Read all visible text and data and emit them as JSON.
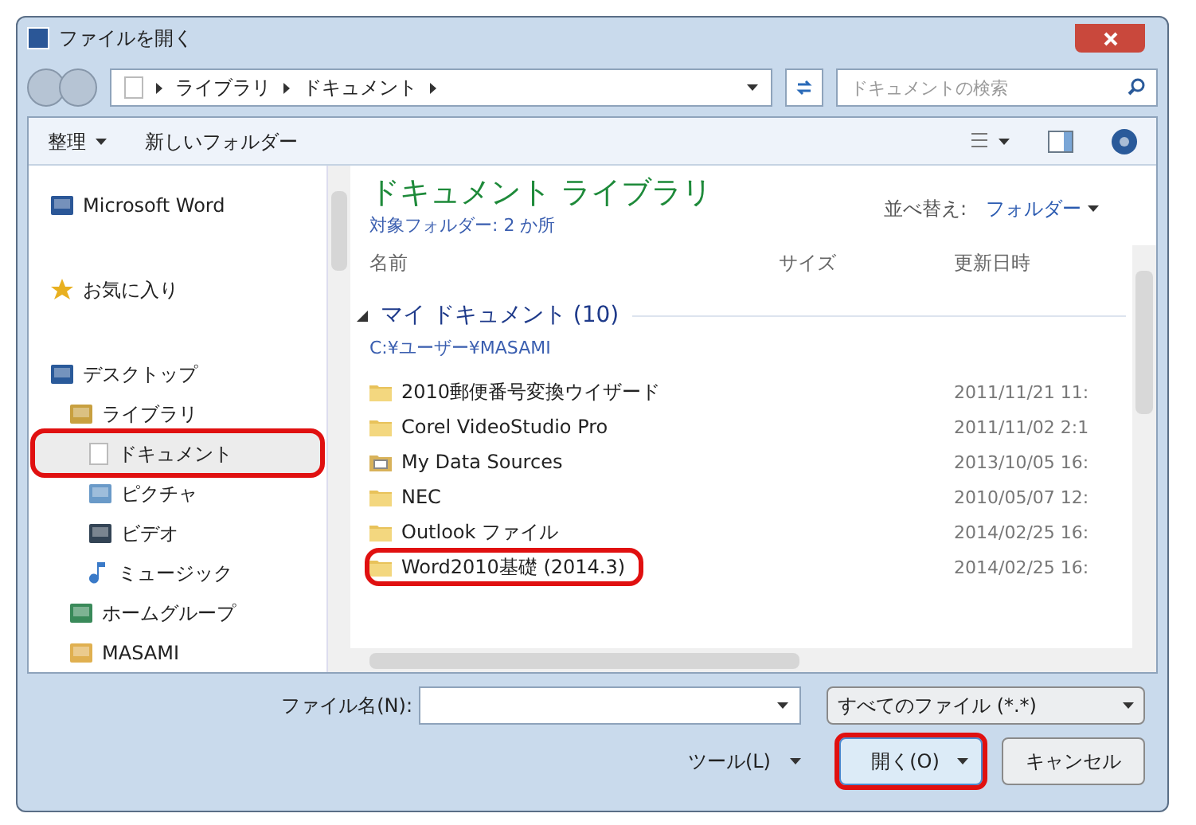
{
  "window": {
    "title": "ファイルを開く"
  },
  "address_bar": {
    "path": [
      "ライブラリ",
      "ドキュメント"
    ],
    "search_placeholder": "ドキュメントの検索"
  },
  "toolbar": {
    "organize": "整理",
    "new_folder": "新しいフォルダー"
  },
  "sidebar": {
    "items": [
      {
        "label": "Microsoft Word",
        "kind": "word",
        "selected": false,
        "annotated": false
      },
      {
        "label": "お気に入り",
        "kind": "star",
        "selected": false,
        "annotated": false
      },
      {
        "label": "デスクトップ",
        "kind": "desktop",
        "selected": false,
        "annotated": false,
        "children": [
          {
            "label": "ライブラリ",
            "kind": "library",
            "selected": false,
            "annotated": false,
            "children": [
              {
                "label": "ドキュメント",
                "kind": "document",
                "selected": true,
                "annotated": true
              },
              {
                "label": "ピクチャ",
                "kind": "picture",
                "selected": false,
                "annotated": false
              },
              {
                "label": "ビデオ",
                "kind": "video",
                "selected": false,
                "annotated": false
              },
              {
                "label": "ミュージック",
                "kind": "music",
                "selected": false,
                "annotated": false
              }
            ]
          },
          {
            "label": "ホームグループ",
            "kind": "homegroup",
            "selected": false,
            "annotated": false
          },
          {
            "label": "MASAMI",
            "kind": "user",
            "selected": false,
            "annotated": false
          }
        ]
      }
    ]
  },
  "library": {
    "title": "ドキュメント ライブラリ",
    "subtitle": "対象フォルダー: 2 か所",
    "sort_label": "並べ替え:",
    "sort_value": "フォルダー"
  },
  "table": {
    "columns": [
      "名前",
      "サイズ",
      "更新日時"
    ],
    "group": {
      "label": "マイ ドキュメント (10)",
      "path": "C:¥ユーザー¥MASAMI",
      "expanded": true
    },
    "rows": [
      {
        "name": "2010郵便番号変換ウイザード",
        "kind": "folder",
        "date": "2011/11/21 11:",
        "annotated": false
      },
      {
        "name": "Corel VideoStudio Pro",
        "kind": "folder",
        "date": "2011/11/02 2:1",
        "annotated": false
      },
      {
        "name": "My Data Sources",
        "kind": "datasource",
        "date": "2013/10/05 16:",
        "annotated": false
      },
      {
        "name": "NEC",
        "kind": "folder",
        "date": "2010/05/07 12:",
        "annotated": false
      },
      {
        "name": "Outlook ファイル",
        "kind": "folder",
        "date": "2014/02/25 16:",
        "annotated": false
      },
      {
        "name": "Word2010基礎 (2014.3)",
        "kind": "folder",
        "date": "2014/02/25 16:",
        "annotated": true
      }
    ]
  },
  "footer": {
    "filename_label": "ファイル名(N):",
    "filter": "すべてのファイル (*.*)",
    "tools": "ツール(L)",
    "open": "開く(O)",
    "open_annotated": true,
    "cancel": "キャンセル"
  }
}
